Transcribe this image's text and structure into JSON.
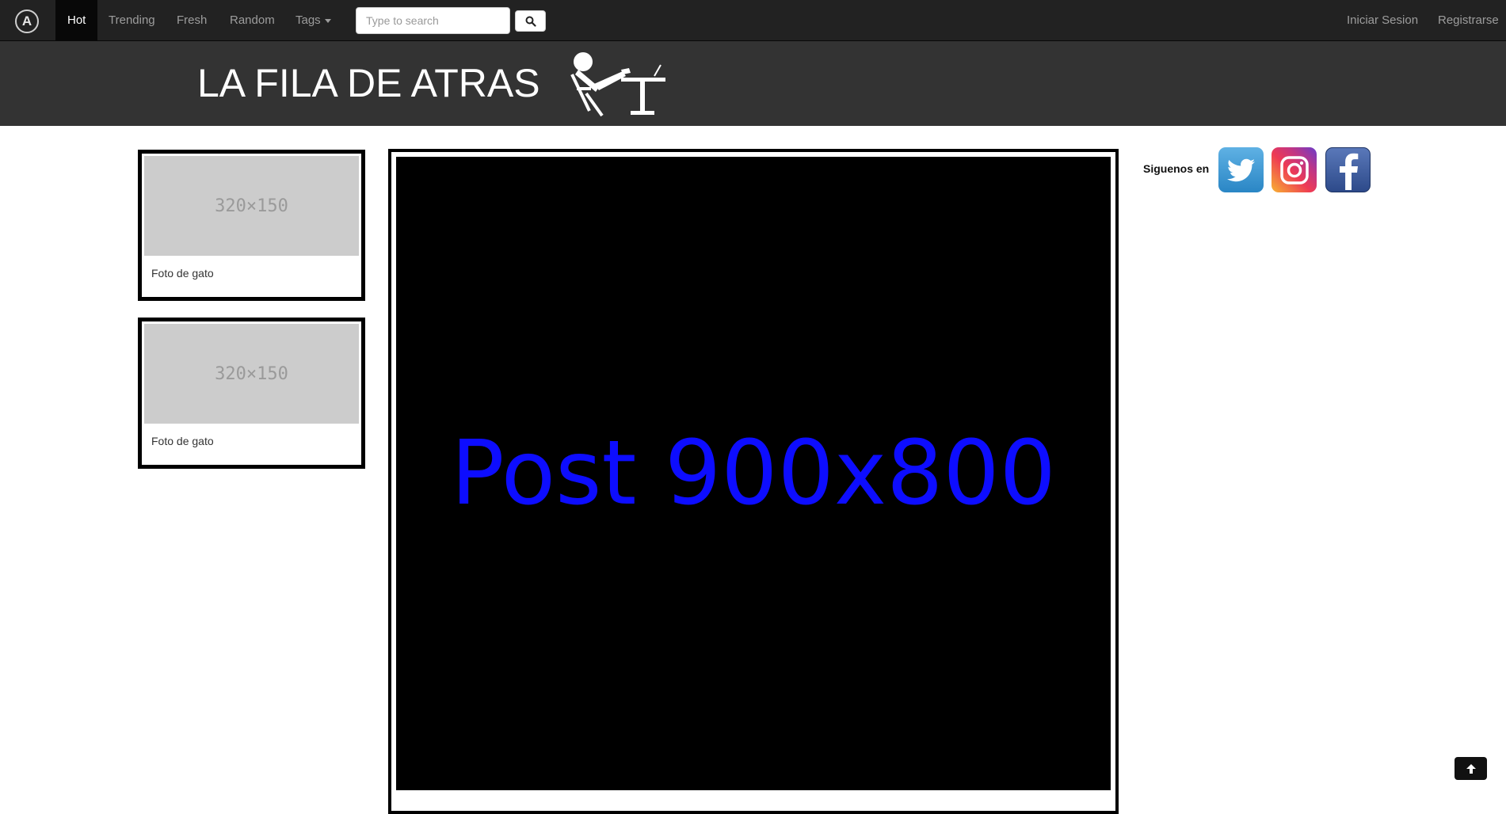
{
  "nav": {
    "logo_icon": "circle-a-logo-icon",
    "items": [
      "Hot",
      "Trending",
      "Fresh",
      "Random",
      "Tags"
    ],
    "active": "Hot",
    "search_placeholder": "Type to search",
    "search_icon": "search-icon",
    "login": "Iniciar Sesion",
    "register": "Registrarse"
  },
  "banner": {
    "title": "LA FILA DE ATRAS",
    "figure_icon": "student-at-desk-icon"
  },
  "sidebar": {
    "cards": [
      {
        "image_text": "320×150",
        "caption": "Foto de gato"
      },
      {
        "image_text": "320×150",
        "caption": "Foto de gato"
      }
    ]
  },
  "post": {
    "text": "Post 900x800"
  },
  "social": {
    "label": "Siguenos en",
    "networks": [
      "twitter-icon",
      "instagram-icon",
      "facebook-icon"
    ]
  },
  "back_to_top_icon": "arrow-up-icon",
  "colors": {
    "navbar_bg": "#222222",
    "banner_bg": "#333333",
    "post_text": "#0d0dff"
  }
}
